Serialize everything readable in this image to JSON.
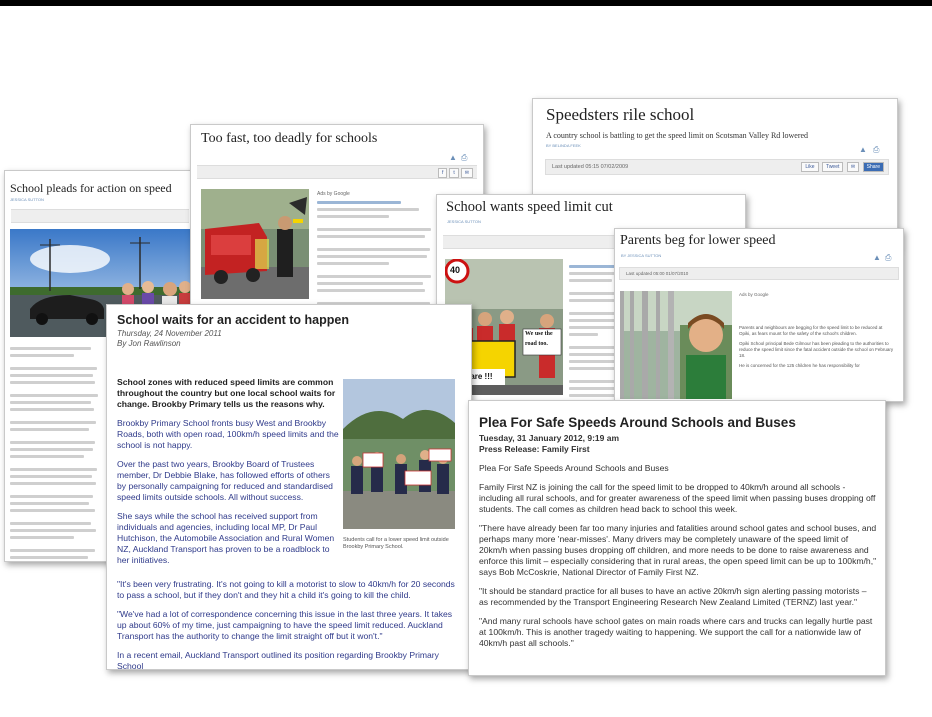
{
  "articles": {
    "pleads": {
      "title": "School pleads for action on speed",
      "byline": "JESSICA SUTTON"
    },
    "too_fast": {
      "title": "Too fast, too deadly for schools",
      "ads_label": "Ads by Google"
    },
    "speedsters": {
      "title": "Speedsters rile school",
      "subtitle": "A country school is battling to get the speed limit on Scotsman Valley Rd lowered",
      "byline": "BY BELINDA FEEK",
      "updated": "Last updated 05:15 07/02/2009",
      "like": "Like",
      "tweet": "Tweet",
      "share": "Share"
    },
    "limit_cut": {
      "title": "School wants speed limit cut",
      "byline": "JESSICA SUTTON"
    },
    "parents": {
      "title": "Parents beg for lower speed",
      "byline": "BY JESSICA SUTTON",
      "updated": "Last updated 05:00 01/07/2010",
      "ads_label": "Ads by Google",
      "para1": "Parents and neighbours are begging for the speed limit to be reduced at Opiki, as fears mount for the safety of the school's children.",
      "para2": "Opiki School principal Bede Gilmour has been pleading to the authorities to reduce the speed limit since the fatal accident outside the school on February 18.",
      "para3": "He is concerned for the 125 children he has responsibility for"
    },
    "waits": {
      "title": "School waits for an accident to happen",
      "date": "Thursday, 24 November 2011",
      "author": "By Jon Rawlinson",
      "lead": "School zones with reduced speed limits are common throughout the country but one local school waits for change. Brookby Primary tells us the reasons why.",
      "p1": "Brookby Primary School fronts busy West and Brookby Roads, both with open road, 100km/h speed limits and the school is not happy.",
      "p2": "Over the past two years, Brookby Board of Trustees member, Dr Debbie Blake, has followed efforts of others by personally campaigning for reduced and standardised speed limits outside schools. All without success.",
      "p3": "She says while the school has received support from individuals and agencies, including local MP, Dr Paul Hutchison, the Automobile Association and Rural Women NZ, Auckland Transport has proven to be a roadblock to her initiatives.",
      "p4": "\"It's been very frustrating. It's not going to kill a motorist to slow to 40km/h for 20 seconds to pass a school, but if they don't and they hit a child it's going to kill the child.",
      "p5": "\"We've had a lot of correspondence concerning this issue in the last three years. It takes up about 60% of my time, just campaigning to have the speed limit reduced. Auckland Transport has the authority to change the limit straight off but it won't.\"",
      "p6": "In a recent email, Auckland Transport outlined its position regarding Brookby Primary School",
      "caption": "Students call for a lower speed limit outside Brookby Primary School."
    },
    "plea": {
      "title": "Plea For Safe Speeds Around Schools and Buses",
      "date": "Tuesday, 31 January 2012, 9:19 am",
      "source": "Press Release: Family First",
      "p0": "Plea For Safe Speeds Around Schools and Buses",
      "p1": "Family First NZ is joining the call for the speed limit to be dropped to 40km/h around all schools - including all rural schools, and for greater awareness of the speed limit when passing buses dropping off students. The call comes as children head back to school this week.",
      "p2": "\"There have already been far too many injuries and fatalities around school gates and school buses, and perhaps many more 'near-misses'. Many drivers may be completely unaware of the speed limit of 20km/h when passing buses dropping off children, and more needs to be done to raise awareness and enforce this limit – especially considering that in rural areas, the open speed limit can be up to 100km/h,\" says Bob McCoskrie, National Director of Family First NZ.",
      "p3": "\"It should be standard practice for all buses to have an active 20km/h sign alerting passing motorists – as recommended by the Transport Engineering Research New Zealand Limited (TERNZ) last year.\"",
      "p4": "\"And many rural schools have school gates on main roads where cars and trucks can legally hurtle past at 100km/h. This is another tragedy waiting to happening. We support the call for a nationwide law of 40km/h past all schools.\""
    }
  },
  "signs": {
    "speed_40": "40",
    "we_use": "We use the",
    "road_too": "road too.",
    "take_care": "Take care !!!"
  },
  "icons": [
    "facebook-like-icon",
    "tweet-icon",
    "share-icon",
    "print-icon",
    "email-icon"
  ],
  "colors": {
    "top_bar": "#000000",
    "link_blue": "#3b5998",
    "sign_yellow": "#f5d400"
  }
}
